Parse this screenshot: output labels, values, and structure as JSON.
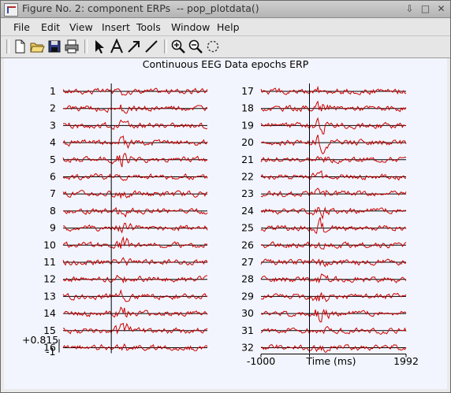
{
  "window": {
    "title": "Figure No. 2: component ERPs  -- pop_plotdata()",
    "buttons": [
      "⇩",
      "□",
      "✕"
    ]
  },
  "menu": {
    "items": [
      "File",
      "Edit",
      "View",
      "Insert",
      "Tools",
      "Window",
      "Help"
    ]
  },
  "toolbar": {
    "icons": [
      "new-file-icon",
      "open-folder-icon",
      "save-icon",
      "print-icon",
      "select-arrow-icon",
      "text-insert-icon",
      "arrow-insert-icon",
      "line-insert-icon",
      "zoom-in-icon",
      "zoom-out-icon",
      "rotate-icon"
    ]
  },
  "figure": {
    "title": "Continuous EEG Data epochs ERP",
    "scale_top": "+0.815",
    "scale_bottom": "-1",
    "xaxis": {
      "min_label": "-1000",
      "label": "Time (ms)",
      "max_label": "1992"
    },
    "colors": {
      "trace": "#cc0000",
      "axis": "#000000",
      "background": "#f2f5fd"
    }
  },
  "chart_data": {
    "type": "line",
    "title": "Continuous EEG Data epochs ERP",
    "xlabel": "Time (ms)",
    "xlim": [
      -1000,
      1992
    ],
    "stimulus_onset_ms": 0,
    "channels": [
      "1",
      "2",
      "3",
      "4",
      "5",
      "6",
      "7",
      "8",
      "9",
      "10",
      "11",
      "12",
      "13",
      "14",
      "15",
      "16",
      "17",
      "18",
      "19",
      "20",
      "21",
      "22",
      "23",
      "24",
      "25",
      "26",
      "27",
      "28",
      "29",
      "30",
      "31",
      "32"
    ],
    "scale": {
      "top": 0.815,
      "bottom": -1
    },
    "grid": false
  }
}
